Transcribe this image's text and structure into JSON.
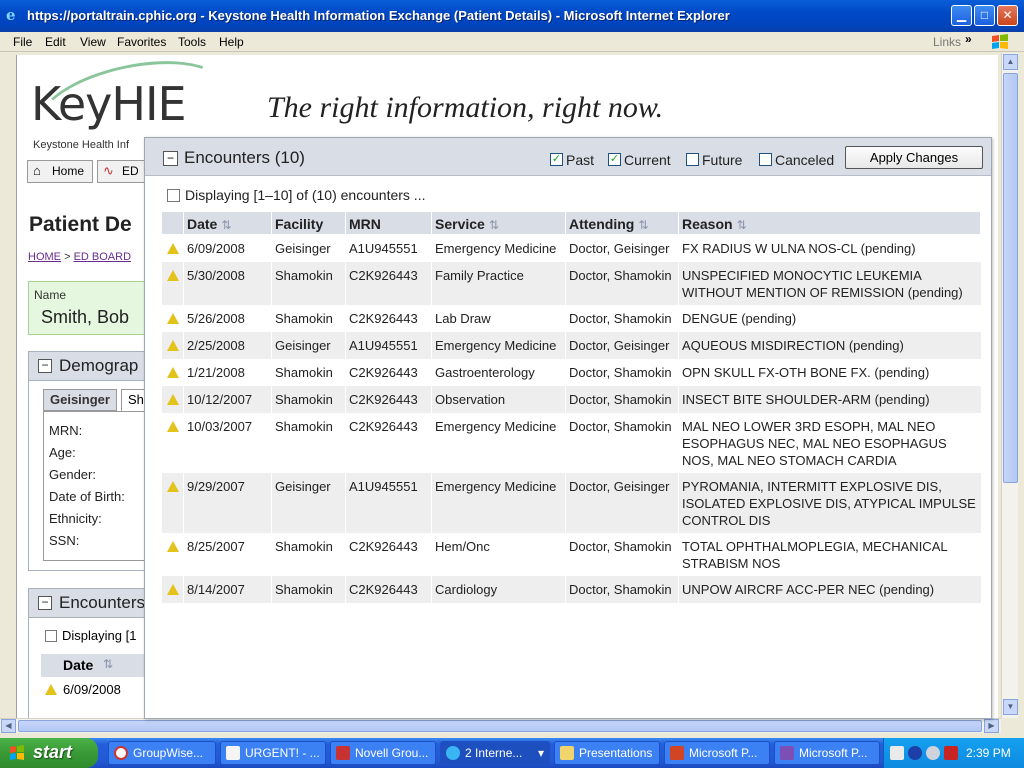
{
  "window": {
    "title": "https://portaltrain.cphic.org - Keystone Health Information Exchange (Patient Details) - Microsoft Internet Explorer",
    "icon": "ie-icon"
  },
  "menu": [
    "File",
    "Edit",
    "View",
    "Favorites",
    "Tools",
    "Help"
  ],
  "links_label": "Links",
  "background_page": {
    "logo_text": "KeyHIE",
    "logo_sub": "Keystone Health Inf",
    "tagline": "The right information, right now.",
    "nav": [
      "Home",
      "ED"
    ],
    "page_title": "Patient De",
    "breadcrumb": [
      "HOME",
      ">",
      "ED BOARD"
    ],
    "name_label": "Name",
    "name_value": "Smith, Bob",
    "demographics_title": "Demograp",
    "subtabs": [
      "Geisinger",
      "Sh"
    ],
    "demo_fields": [
      "MRN:",
      "Age:",
      "Gender:",
      "Date of Birth:",
      "Ethnicity:",
      "SSN:"
    ],
    "encounters_title": "Encounters",
    "encounters_display": "Displaying [1",
    "encounters_col": "Date",
    "encounters_first": "6/09/2008"
  },
  "modal": {
    "title": "Encounters (10)",
    "filters": [
      {
        "label": "Past",
        "checked": true
      },
      {
        "label": "Current",
        "checked": true
      },
      {
        "label": "Future",
        "checked": false
      },
      {
        "label": "Canceled",
        "checked": false
      }
    ],
    "apply_label": "Apply Changes",
    "displaying": "Displaying [1–10] of (10) encounters ...",
    "columns": [
      "Date",
      "Facility",
      "MRN",
      "Service",
      "Attending",
      "Reason"
    ],
    "sortable": [
      true,
      false,
      false,
      true,
      true,
      true
    ],
    "rows": [
      {
        "date": "6/09/2008",
        "facility": "Geisinger",
        "mrn": "A1U945551",
        "service": "Emergency Medicine",
        "attending": "Doctor, Geisinger",
        "reason": "FX RADIUS W ULNA NOS-CL (pending)"
      },
      {
        "date": "5/30/2008",
        "facility": "Shamokin",
        "mrn": "C2K926443",
        "service": "Family Practice",
        "attending": "Doctor, Shamokin",
        "reason": "UNSPECIFIED MONOCYTIC LEUKEMIA WITHOUT MENTION OF REMISSION (pending)"
      },
      {
        "date": "5/26/2008",
        "facility": "Shamokin",
        "mrn": "C2K926443",
        "service": "Lab Draw",
        "attending": "Doctor, Shamokin",
        "reason": "DENGUE (pending)"
      },
      {
        "date": "2/25/2008",
        "facility": "Geisinger",
        "mrn": "A1U945551",
        "service": "Emergency Medicine",
        "attending": "Doctor, Geisinger",
        "reason": "AQUEOUS MISDIRECTION (pending)"
      },
      {
        "date": "1/21/2008",
        "facility": "Shamokin",
        "mrn": "C2K926443",
        "service": "Gastroenterology",
        "attending": "Doctor, Shamokin",
        "reason": "OPN SKULL FX-OTH BONE FX. (pending)"
      },
      {
        "date": "10/12/2007",
        "facility": "Shamokin",
        "mrn": "C2K926443",
        "service": "Observation",
        "attending": "Doctor, Shamokin",
        "reason": "INSECT BITE SHOULDER-ARM (pending)"
      },
      {
        "date": "10/03/2007",
        "facility": "Shamokin",
        "mrn": "C2K926443",
        "service": "Emergency Medicine",
        "attending": "Doctor, Shamokin",
        "reason": "MAL NEO LOWER 3RD ESOPH, MAL NEO ESOPHAGUS NEC, MAL NEO ESOPHAGUS NOS, MAL NEO STOMACH CARDIA"
      },
      {
        "date": "9/29/2007",
        "facility": "Geisinger",
        "mrn": "A1U945551",
        "service": "Emergency Medicine",
        "attending": "Doctor, Geisinger",
        "reason": "PYROMANIA, INTERMITT EXPLOSIVE DIS, ISOLATED EXPLOSIVE DIS, ATYPICAL IMPULSE CONTROL DIS"
      },
      {
        "date": "8/25/2007",
        "facility": "Shamokin",
        "mrn": "C2K926443",
        "service": "Hem/Onc",
        "attending": "Doctor, Shamokin",
        "reason": "TOTAL OPHTHALMOPLEGIA, MECHANICAL STRABISM NOS"
      },
      {
        "date": "8/14/2007",
        "facility": "Shamokin",
        "mrn": "C2K926443",
        "service": "Cardiology",
        "attending": "Doctor, Shamokin",
        "reason": "UNPOW AIRCRF ACC-PER NEC (pending)"
      }
    ]
  },
  "taskbar": {
    "start_label": "start",
    "items": [
      {
        "label": "GroupWise...",
        "icon": "groupwise-icon",
        "active": false
      },
      {
        "label": "URGENT! - ...",
        "icon": "document-icon",
        "active": false
      },
      {
        "label": "Novell Grou...",
        "icon": "novell-icon",
        "active": false
      },
      {
        "label": "2 Interne...",
        "icon": "ie-icon",
        "active": true
      },
      {
        "label": "Presentations",
        "icon": "folder-icon",
        "active": false
      },
      {
        "label": "Microsoft P...",
        "icon": "powerpoint-icon",
        "active": false
      },
      {
        "label": "Microsoft P...",
        "icon": "project-icon",
        "active": false
      }
    ],
    "clock": "2:39 PM"
  }
}
